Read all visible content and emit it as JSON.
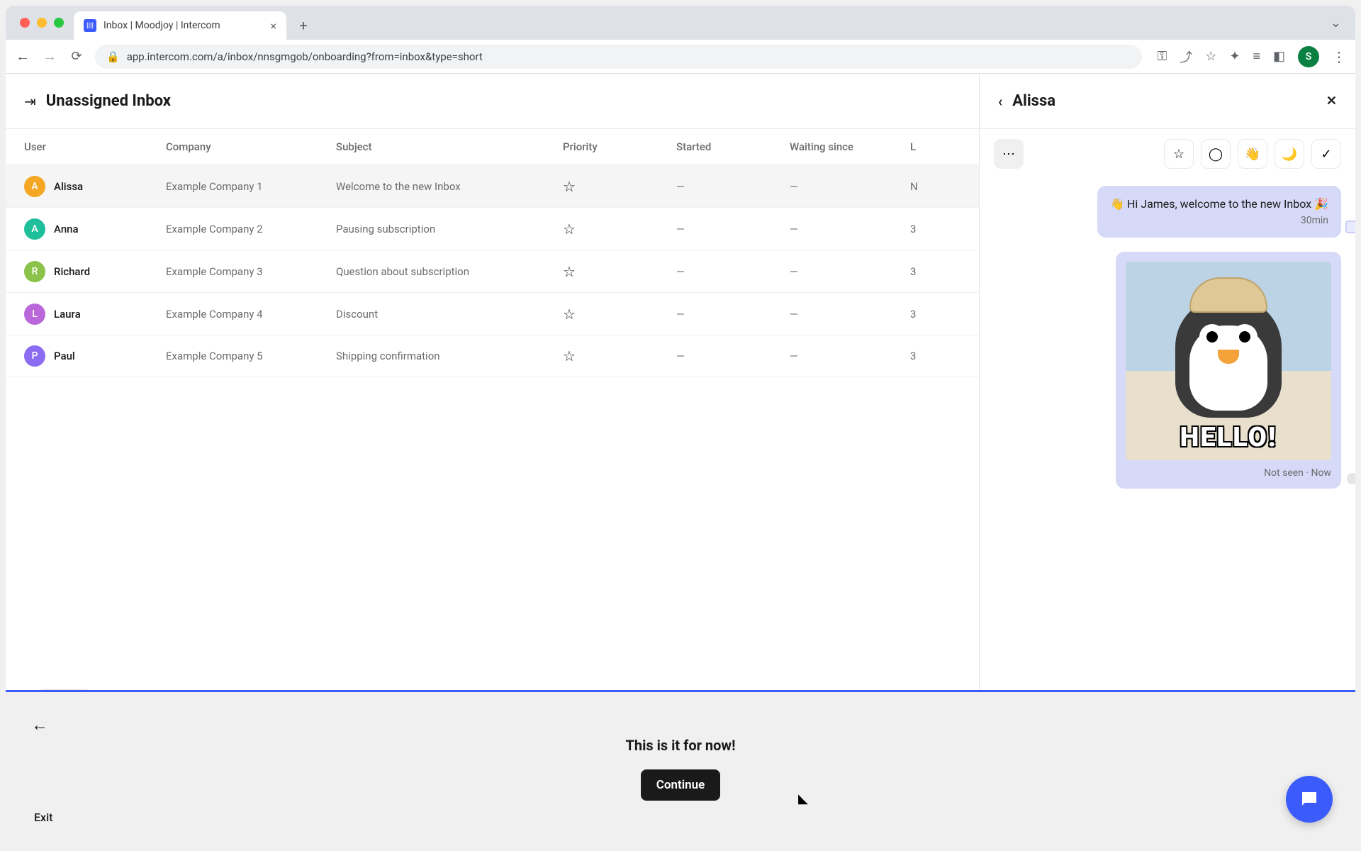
{
  "browser": {
    "tab_title": "Inbox | Moodjoy | Intercom",
    "url": "app.intercom.com/a/inbox/nnsgmgob/onboarding?from=inbox&type=short",
    "profile_initial": "S"
  },
  "main": {
    "title": "Unassigned Inbox",
    "columns": {
      "user": "User",
      "company": "Company",
      "subject": "Subject",
      "priority": "Priority",
      "started": "Started",
      "waiting": "Waiting since",
      "last_cutoff": "L"
    },
    "rows": [
      {
        "initial": "A",
        "name": "Alissa",
        "color": "#f5a623",
        "company": "Example Company 1",
        "subject": "Welcome to the new Inbox",
        "started": "—",
        "waiting": "—",
        "selected": true,
        "last_cutoff": "N"
      },
      {
        "initial": "A",
        "name": "Anna",
        "color": "#1fbf9c",
        "company": "Example Company 2",
        "subject": "Pausing subscription",
        "started": "—",
        "waiting": "—",
        "selected": false,
        "last_cutoff": "3"
      },
      {
        "initial": "R",
        "name": "Richard",
        "color": "#8bc34a",
        "company": "Example Company 3",
        "subject": "Question about subscription",
        "started": "—",
        "waiting": "—",
        "selected": false,
        "last_cutoff": "3"
      },
      {
        "initial": "L",
        "name": "Laura",
        "color": "#b967d9",
        "company": "Example Company 4",
        "subject": "Discount",
        "started": "—",
        "waiting": "—",
        "selected": false,
        "last_cutoff": "3"
      },
      {
        "initial": "P",
        "name": "Paul",
        "color": "#8c6cf2",
        "company": "Example Company 5",
        "subject": "Shipping confirmation",
        "started": "—",
        "waiting": "—",
        "selected": false,
        "last_cutoff": "3"
      }
    ]
  },
  "sidepanel": {
    "name": "Alissa",
    "toolbar_icons": {
      "more": "⋯",
      "star": "☆",
      "snooze": "🌙",
      "wave": "👋",
      "check": "✓",
      "assignee": "◯"
    },
    "message1_text": "👋 Hi James, welcome to the new Inbox 🎉",
    "message1_time": "30min",
    "gif_caption": "HELLO!",
    "message2_status": "Not seen · Now"
  },
  "onboard": {
    "title": "This is it for now!",
    "button": "Continue",
    "exit": "Exit"
  }
}
